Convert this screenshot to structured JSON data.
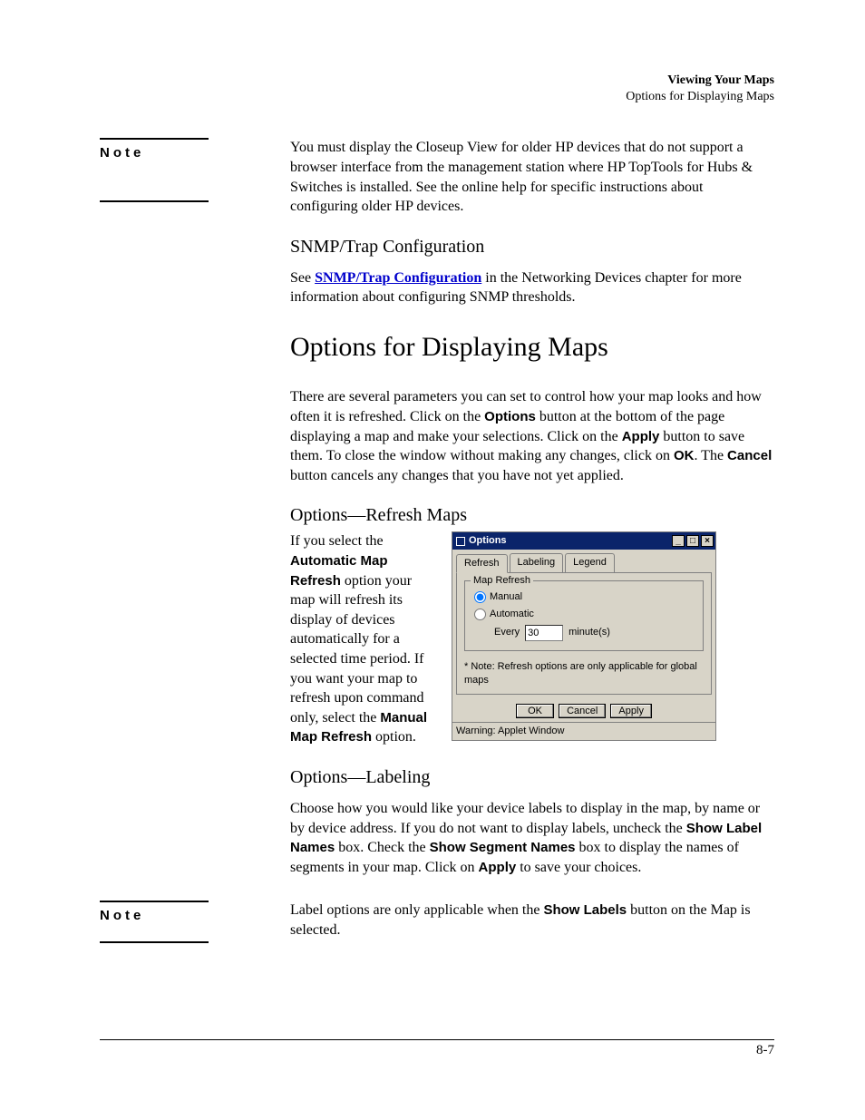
{
  "header": {
    "title_bold": "Viewing Your Maps",
    "subtitle": "Options for Displaying Maps"
  },
  "note1": {
    "label": "Note",
    "body": "You must display the Closeup View for older HP devices that do not support a browser interface from the management station where HP TopTools for Hubs & Switches is installed. See the online help for specific instructions about configuring older HP devices."
  },
  "snmp": {
    "heading": "SNMP/Trap Configuration",
    "prefix": "See ",
    "link": "SNMP/Trap Configuration",
    "suffix": " in the Networking Devices chapter for more information about configuring SNMP thresholds."
  },
  "section_title": "Options for Displaying Maps",
  "intro": {
    "t1": "There are several parameters you can set to control how your map looks and how often it is refreshed. Click on the ",
    "b1": "Options",
    "t2": " button at the bottom of the page displaying a map and make your selections. Click on the ",
    "b2": "Apply",
    "t3": " button to save them. To close the window without making any changes, click on ",
    "b3": "OK",
    "t4": ". The ",
    "b4": "Cancel",
    "t5": " button cancels any changes that you have not yet applied."
  },
  "refresh": {
    "heading": "Options—Refresh Maps",
    "t1": "If you select the ",
    "b1": "Automatic Map Refresh",
    "t2": " option your map will refresh its display of devices automatically for a selected time period. If you want your map to refresh upon command only, select the ",
    "b2": "Manual Map Refresh",
    "t3": " option."
  },
  "dialog": {
    "title": "Options",
    "tabs": [
      "Refresh",
      "Labeling",
      "Legend"
    ],
    "group_legend": "Map Refresh",
    "radio_manual": "Manual",
    "radio_auto": "Automatic",
    "every_label": "Every",
    "every_value": "30",
    "every_unit": "minute(s)",
    "footnote": "* Note: Refresh options are only applicable for global maps",
    "btn_ok": "OK",
    "btn_cancel": "Cancel",
    "btn_apply": "Apply",
    "status": "Warning: Applet Window",
    "win_min": "_",
    "win_max": "□",
    "win_close": "×"
  },
  "labeling": {
    "heading": "Options—Labeling",
    "t1": "Choose how you would like your device labels to display in the map, by name or by device address. If you do not want to display labels, uncheck the ",
    "b1": "Show Label Names",
    "t2": " box. Check the ",
    "b2": "Show Segment Names",
    "t3": " box to display the names of segments in your map. Click on ",
    "b3": "Apply",
    "t4": " to save your choices."
  },
  "note2": {
    "label": "Note",
    "t1": "Label options are only applicable when the ",
    "b1": "Show Labels",
    "t2": " button on the Map is selected."
  },
  "page_number": "8-7"
}
